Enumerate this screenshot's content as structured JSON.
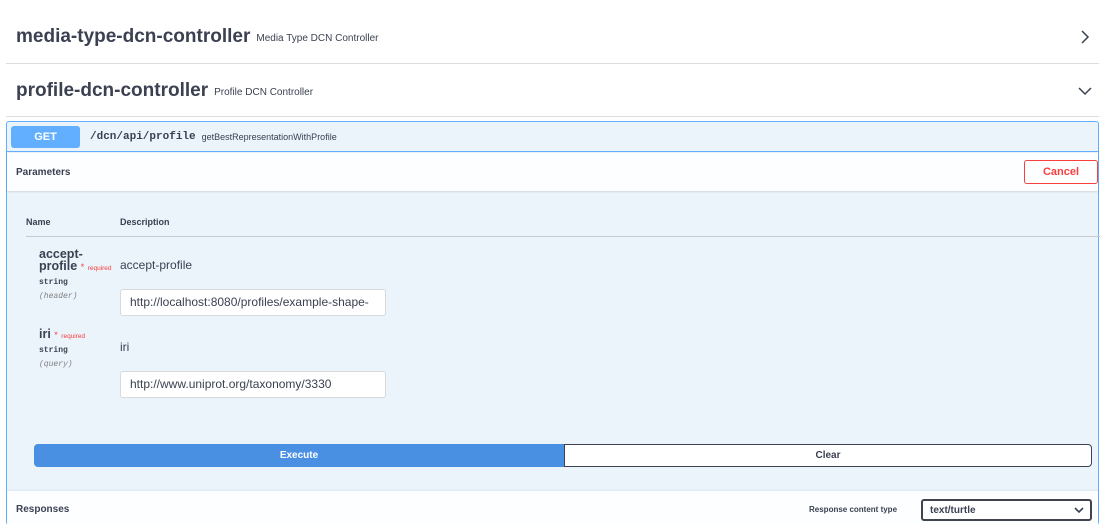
{
  "sections": [
    {
      "name": "media-type-dcn-controller",
      "description": "Media Type DCN Controller",
      "state": "collapsed"
    },
    {
      "name": "profile-dcn-controller",
      "description": "Profile DCN Controller",
      "state": "expanded"
    }
  ],
  "operation": {
    "method": "GET",
    "path": "/dcn/api/profile",
    "operation_id": "getBestRepresentationWithProfile",
    "method_color": "#61affe"
  },
  "parameters": {
    "title": "Parameters",
    "cancel_label": "Cancel",
    "columns": {
      "name": "Name",
      "description": "Description"
    },
    "items": [
      {
        "name_line1": "accept-",
        "name_line2": "profile",
        "required_star": "*",
        "required_text": "required",
        "type": "string",
        "in": "(header)",
        "description": "accept-profile",
        "value": "http://localhost:8080/profiles/example-shape-"
      },
      {
        "name": "iri",
        "required_star": "*",
        "required_text": "required",
        "type": "string",
        "in": "(query)",
        "description": "iri",
        "value": "http://www.uniprot.org/taxonomy/3330"
      }
    ]
  },
  "actions": {
    "execute_label": "Execute",
    "clear_label": "Clear"
  },
  "responses": {
    "title": "Responses",
    "content_type_label": "Response content type",
    "content_type_value": "text/turtle"
  },
  "icons": {
    "collapsed": "chevron-right-icon",
    "expanded": "chevron-down-icon",
    "select": "chevron-down-icon"
  },
  "colors": {
    "accent_blue": "#61affe",
    "execute_blue": "#4990e2",
    "danger": "#f93e3e",
    "text": "#3b4151"
  }
}
